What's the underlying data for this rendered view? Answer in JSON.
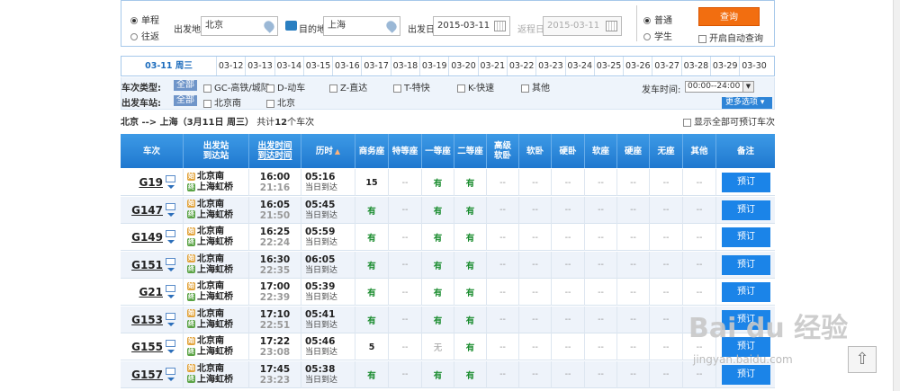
{
  "search": {
    "trip_types": [
      "单程",
      "往返"
    ],
    "from_label": "出发地",
    "from_value": "北京",
    "to_label": "目的地",
    "to_value": "上海",
    "depart_label": "出发日",
    "depart_value": "2015-03-11",
    "return_label": "返程日",
    "return_value": "2015-03-11",
    "passenger_types": [
      "普通",
      "学生"
    ],
    "query_button": "查询",
    "auto_query_label": "开启自动查询"
  },
  "date_tabs": [
    "03-11  周三",
    "03-12",
    "03-13",
    "03-14",
    "03-15",
    "03-16",
    "03-17",
    "03-18",
    "03-19",
    "03-20",
    "03-21",
    "03-22",
    "03-23",
    "03-24",
    "03-25",
    "03-26",
    "03-27",
    "03-28",
    "03-29",
    "03-30"
  ],
  "filters": {
    "type_label": "车次类型:",
    "all_label": "全部",
    "types": [
      "GC-高铁/城际",
      "D-动车",
      "Z-直达",
      "T-特快",
      "K-快速",
      "其他"
    ],
    "station_label": "出发车站:",
    "stations": [
      "北京南",
      "北京"
    ],
    "time_label": "发车时间:",
    "time_value": "00:00--24:00",
    "more_label": "更多选项"
  },
  "summary": {
    "route": "北京 --> 上海（3月11日  周三）",
    "count_prefix": "共计",
    "count": "12",
    "count_suffix": "个车次",
    "show_all_label": "显示全部可预订车次"
  },
  "headers": {
    "train": "车次",
    "station_dep": "出发站",
    "station_arr": "到达站",
    "time_dep": "出发时间",
    "time_arr": "到达时间",
    "duration": "历时",
    "business": "商务座",
    "special": "特等座",
    "first": "一等座",
    "second": "二等座",
    "premium1": "高级",
    "premium2": "软卧",
    "soft_sleeper": "软卧",
    "hard_sleeper": "硬卧",
    "soft_seat": "软座",
    "hard_seat": "硬座",
    "no_seat": "无座",
    "other": "其他",
    "remark": "备注"
  },
  "badges": {
    "start": "始",
    "end": "终"
  },
  "rows": [
    {
      "train": "G19",
      "dep_station": "北京南",
      "arr_station": "上海虹桥",
      "dep_time": "16:00",
      "arr_time": "21:16",
      "duration": "05:16",
      "arrive_day": "当日到达",
      "seats": [
        "15",
        "--",
        "有",
        "有",
        "--",
        "--",
        "--",
        "--",
        "--",
        "--",
        "--"
      ],
      "book": "预订"
    },
    {
      "train": "G147",
      "dep_station": "北京南",
      "arr_station": "上海虹桥",
      "dep_time": "16:05",
      "arr_time": "21:50",
      "duration": "05:45",
      "arrive_day": "当日到达",
      "seats": [
        "有",
        "--",
        "有",
        "有",
        "--",
        "--",
        "--",
        "--",
        "--",
        "--",
        "--"
      ],
      "book": "预订"
    },
    {
      "train": "G149",
      "dep_station": "北京南",
      "arr_station": "上海虹桥",
      "dep_time": "16:25",
      "arr_time": "22:24",
      "duration": "05:59",
      "arrive_day": "当日到达",
      "seats": [
        "有",
        "--",
        "有",
        "有",
        "--",
        "--",
        "--",
        "--",
        "--",
        "--",
        "--"
      ],
      "book": "预订"
    },
    {
      "train": "G151",
      "dep_station": "北京南",
      "arr_station": "上海虹桥",
      "dep_time": "16:30",
      "arr_time": "22:35",
      "duration": "06:05",
      "arrive_day": "当日到达",
      "seats": [
        "有",
        "--",
        "有",
        "有",
        "--",
        "--",
        "--",
        "--",
        "--",
        "--",
        "--"
      ],
      "book": "预订"
    },
    {
      "train": "G21",
      "dep_station": "北京南",
      "arr_station": "上海虹桥",
      "dep_time": "17:00",
      "arr_time": "22:39",
      "duration": "05:39",
      "arrive_day": "当日到达",
      "seats": [
        "有",
        "--",
        "有",
        "有",
        "--",
        "--",
        "--",
        "--",
        "--",
        "--",
        "--"
      ],
      "book": "预订"
    },
    {
      "train": "G153",
      "dep_station": "北京南",
      "arr_station": "上海虹桥",
      "dep_time": "17:10",
      "arr_time": "22:51",
      "duration": "05:41",
      "arrive_day": "当日到达",
      "seats": [
        "有",
        "--",
        "有",
        "有",
        "--",
        "--",
        "--",
        "--",
        "--",
        "--",
        "--"
      ],
      "book": "预订"
    },
    {
      "train": "G155",
      "dep_station": "北京南",
      "arr_station": "上海虹桥",
      "dep_time": "17:22",
      "arr_time": "23:08",
      "duration": "05:46",
      "arrive_day": "当日到达",
      "seats": [
        "5",
        "--",
        "无",
        "有",
        "--",
        "--",
        "--",
        "--",
        "--",
        "--",
        "--"
      ],
      "book": "预订"
    },
    {
      "train": "G157",
      "dep_station": "北京南",
      "arr_station": "上海虹桥",
      "dep_time": "17:45",
      "arr_time": "23:23",
      "duration": "05:38",
      "arrive_day": "当日到达",
      "seats": [
        "有",
        "--",
        "有",
        "有",
        "--",
        "--",
        "--",
        "--",
        "--",
        "--",
        "--"
      ],
      "book": "预订"
    }
  ],
  "watermark": {
    "main": "Bai du 经验",
    "sub": "jingyan.baidu.com"
  },
  "to_top": "⇧"
}
